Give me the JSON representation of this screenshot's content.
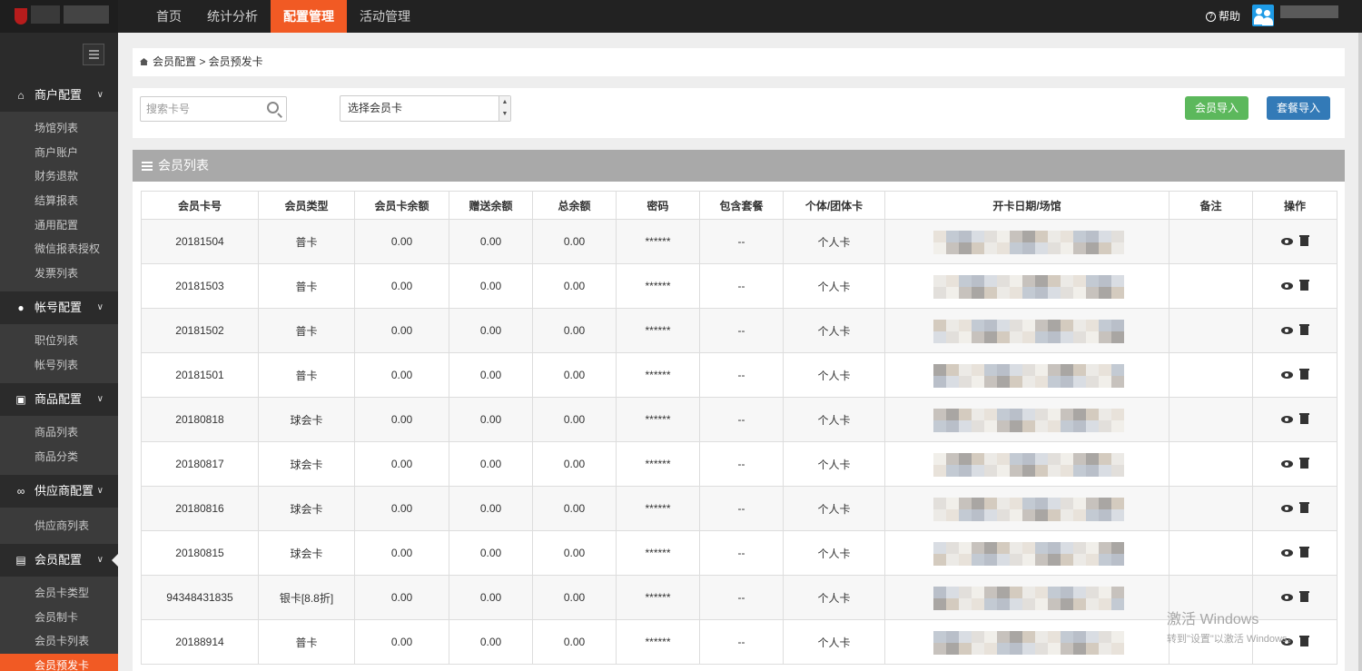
{
  "topbar": {
    "nav": [
      "首页",
      "统计分析",
      "配置管理",
      "活动管理"
    ],
    "active_nav": "配置管理",
    "help_label": "帮助"
  },
  "sidebar": {
    "groups": [
      {
        "label": "商户配置",
        "icon": "home-icon",
        "items": [
          "场馆列表",
          "商户账户",
          "财务退款",
          "结算报表",
          "通用配置",
          "微信报表授权",
          "发票列表"
        ]
      },
      {
        "label": "帐号配置",
        "icon": "user-icon",
        "items": [
          "职位列表",
          "帐号列表"
        ]
      },
      {
        "label": "商品配置",
        "icon": "gift-icon",
        "items": [
          "商品列表",
          "商品分类"
        ]
      },
      {
        "label": "供应商配置",
        "icon": "link-icon",
        "items": [
          "供应商列表"
        ]
      },
      {
        "label": "会员配置",
        "icon": "card-icon",
        "items": [
          "会员卡类型",
          "会员制卡",
          "会员卡列表",
          "会员预发卡"
        ]
      }
    ],
    "active_item": "会员预发卡"
  },
  "breadcrumb": {
    "text": "会员配置 > 会员预发卡"
  },
  "toolbar": {
    "search_placeholder": "搜索卡号",
    "select_value": "选择会员卡",
    "import_member": "会员导入",
    "import_package": "套餐导入"
  },
  "list": {
    "title": "会员列表",
    "columns": [
      "会员卡号",
      "会员类型",
      "会员卡余额",
      "赠送余额",
      "总余额",
      "密码",
      "包含套餐",
      "个体/团体卡",
      "开卡日期/场馆",
      "备注",
      "操作"
    ],
    "rows": [
      [
        "20181504",
        "普卡",
        "0.00",
        "0.00",
        "0.00",
        "******",
        "--",
        "个人卡"
      ],
      [
        "20181503",
        "普卡",
        "0.00",
        "0.00",
        "0.00",
        "******",
        "--",
        "个人卡"
      ],
      [
        "20181502",
        "普卡",
        "0.00",
        "0.00",
        "0.00",
        "******",
        "--",
        "个人卡"
      ],
      [
        "20181501",
        "普卡",
        "0.00",
        "0.00",
        "0.00",
        "******",
        "--",
        "个人卡"
      ],
      [
        "20180818",
        "球会卡",
        "0.00",
        "0.00",
        "0.00",
        "******",
        "--",
        "个人卡"
      ],
      [
        "20180817",
        "球会卡",
        "0.00",
        "0.00",
        "0.00",
        "******",
        "--",
        "个人卡"
      ],
      [
        "20180816",
        "球会卡",
        "0.00",
        "0.00",
        "0.00",
        "******",
        "--",
        "个人卡"
      ],
      [
        "20180815",
        "球会卡",
        "0.00",
        "0.00",
        "0.00",
        "******",
        "--",
        "个人卡"
      ],
      [
        "94348431835",
        "银卡[8.8折]",
        "0.00",
        "0.00",
        "0.00",
        "******",
        "--",
        "个人卡"
      ],
      [
        "20188914",
        "普卡",
        "0.00",
        "0.00",
        "0.00",
        "******",
        "--",
        "个人卡"
      ]
    ]
  },
  "watermark": {
    "line1": "激活 Windows",
    "line2": "转到\"设置\"以激活 Windows。"
  }
}
